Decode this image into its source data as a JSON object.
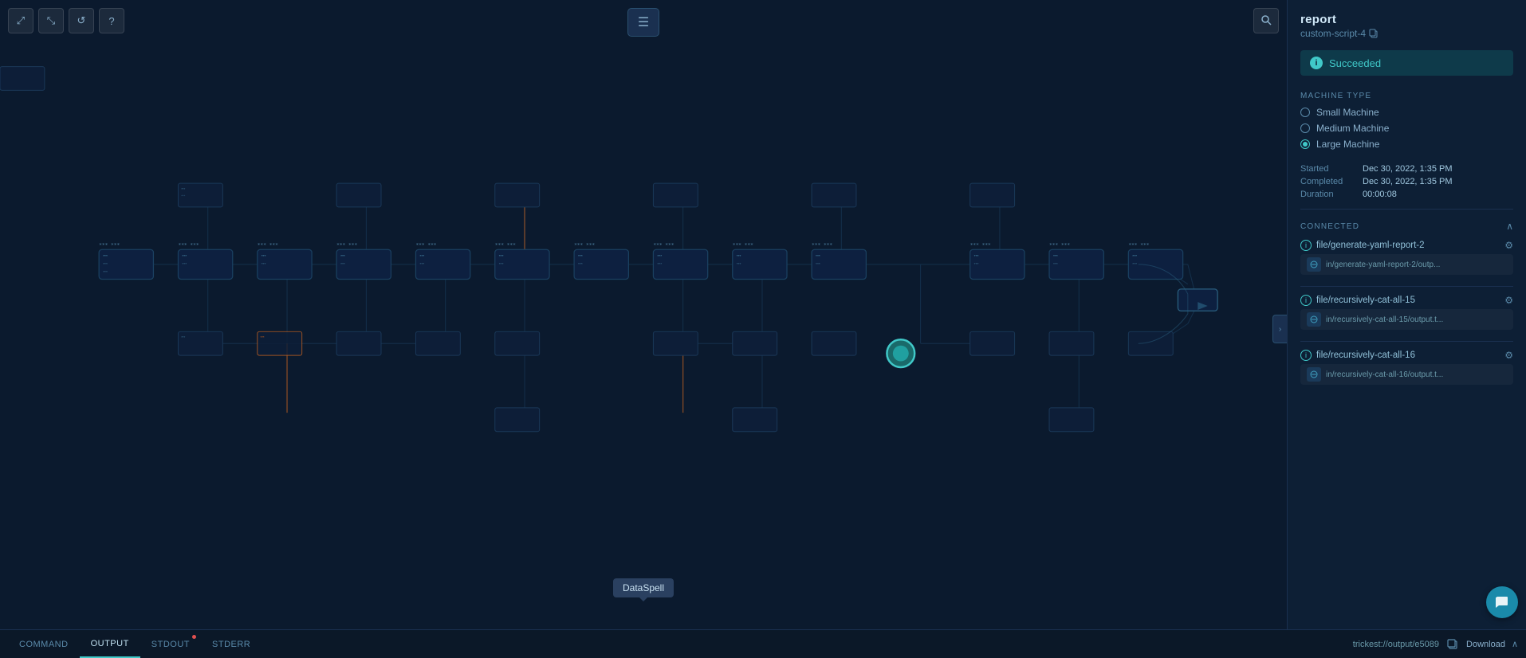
{
  "toolbar": {
    "expand_label": "⤢",
    "fullscreen_label": "⤡",
    "refresh_label": "↺",
    "help_label": "?",
    "search_label": "🔍",
    "list_view_label": "☰"
  },
  "right_panel": {
    "title": "report",
    "subtitle": "custom-script-4",
    "copy_icon": "⎘",
    "status": {
      "text": "Succeeded",
      "icon": "i"
    },
    "machine_type": {
      "label": "MACHINE TYPE",
      "options": [
        {
          "label": "Small Machine",
          "selected": false
        },
        {
          "label": "Medium Machine",
          "selected": false
        },
        {
          "label": "Large Machine",
          "selected": true
        }
      ]
    },
    "timestamps": {
      "started_label": "Started",
      "started_value": "Dec 30, 2022, 1:35 PM",
      "completed_label": "Completed",
      "completed_value": "Dec 30, 2022, 1:35 PM",
      "duration_label": "Duration",
      "duration_value": "00:00:08"
    },
    "connected": {
      "label": "CONNECTED",
      "items": [
        {
          "name": "file/generate-yaml-report-2",
          "path": "in/generate-yaml-report-2/outp..."
        },
        {
          "name": "file/recursively-cat-all-15",
          "path": "in/recursively-cat-all-15/output.t..."
        },
        {
          "name": "file/recursively-cat-all-16",
          "path": "in/recursively-cat-all-16/output.t..."
        }
      ]
    }
  },
  "bottom_bar": {
    "tabs": [
      {
        "label": "COMMAND",
        "active": false,
        "has_dot": false
      },
      {
        "label": "OUTPUT",
        "active": true,
        "has_dot": false
      },
      {
        "label": "STDOUT",
        "active": false,
        "has_dot": true
      },
      {
        "label": "STDERR",
        "active": false,
        "has_dot": false
      }
    ],
    "url": "trickest://output/e5089",
    "download_label": "Download"
  },
  "tooltip": {
    "text": "DataSpell"
  }
}
